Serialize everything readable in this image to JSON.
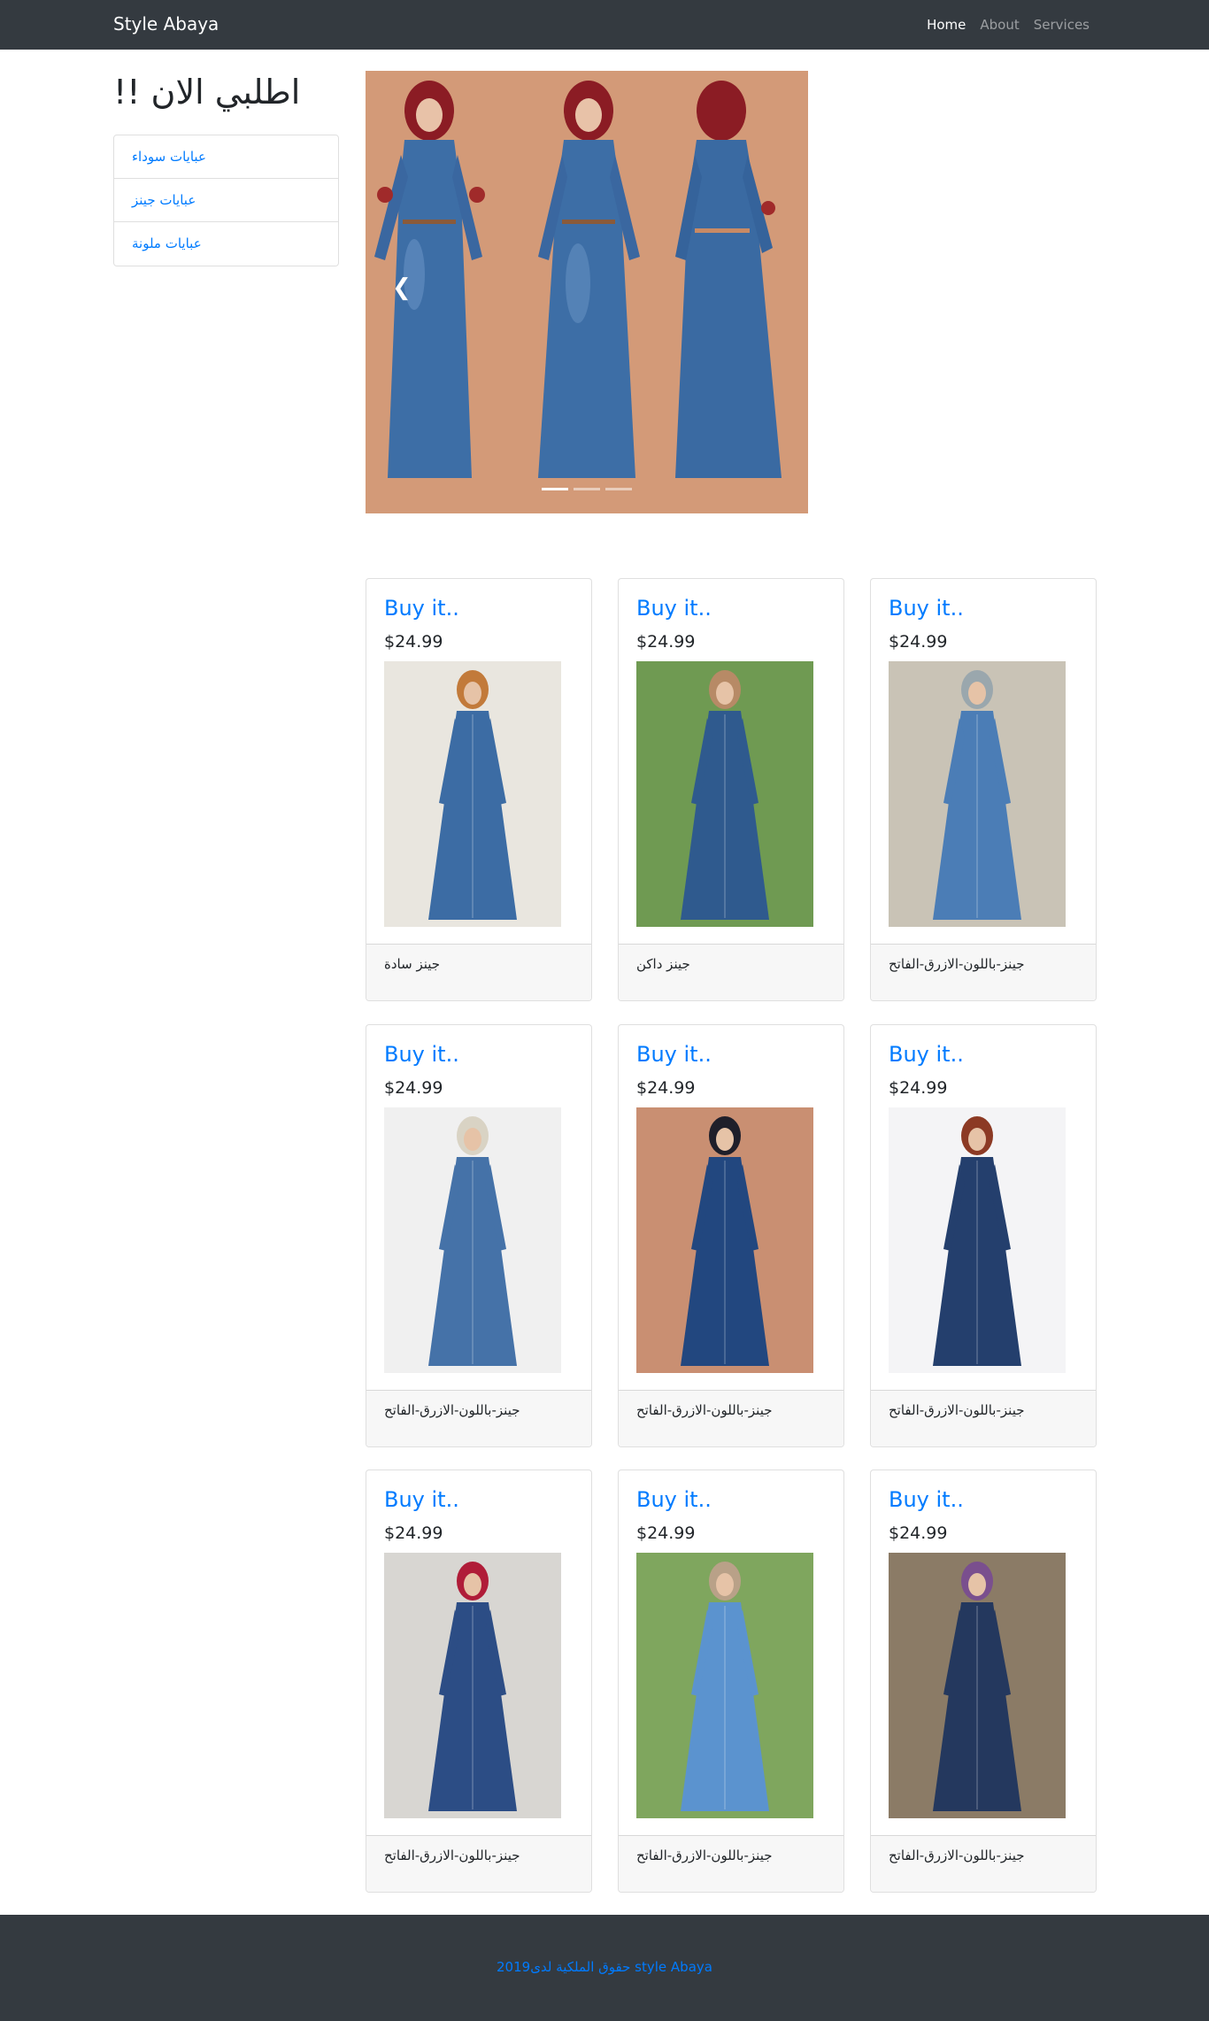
{
  "navbar": {
    "brand": "Style Abaya",
    "links": [
      {
        "label": "Home",
        "active": true
      },
      {
        "label": "About",
        "active": false
      },
      {
        "label": "Services",
        "active": false
      }
    ]
  },
  "sidebar": {
    "title": "اطلبي الان !!",
    "items": [
      {
        "label": "عبايات سوداء"
      },
      {
        "label": "عبايات جينز"
      },
      {
        "label": "عبايات ملونة"
      }
    ]
  },
  "carousel": {
    "prev_icon": "chevron-left-icon",
    "slide_count": 3,
    "active_index": 0
  },
  "products": [
    {
      "title": "Buy it..",
      "price": "$24.99",
      "caption": "جينز سادة"
    },
    {
      "title": "Buy it..",
      "price": "$24.99",
      "caption": "جينز داكن"
    },
    {
      "title": "Buy it..",
      "price": "$24.99",
      "caption": "جينز-باللون-الازرق-الفاتح"
    },
    {
      "title": "Buy it..",
      "price": "$24.99",
      "caption": "جينز-باللون-الازرق-الفاتح"
    },
    {
      "title": "Buy it..",
      "price": "$24.99",
      "caption": "جينز-باللون-الازرق-الفاتح"
    },
    {
      "title": "Buy it..",
      "price": "$24.99",
      "caption": "جينز-باللون-الازرق-الفاتح"
    },
    {
      "title": "Buy it..",
      "price": "$24.99",
      "caption": "جينز-باللون-الازرق-الفاتح"
    },
    {
      "title": "Buy it..",
      "price": "$24.99",
      "caption": "جينز-باللون-الازرق-الفاتح"
    },
    {
      "title": "Buy it..",
      "price": "$24.99",
      "caption": "جينز-باللون-الازرق-الفاتح"
    }
  ],
  "footer": {
    "text": "حقوق الملكية لدى2019 style Abaya"
  },
  "colors": {
    "navbar_bg": "#343a40",
    "link": "#007bff",
    "denim": "#3a68a0",
    "carousel_bg": "#d39a78"
  }
}
